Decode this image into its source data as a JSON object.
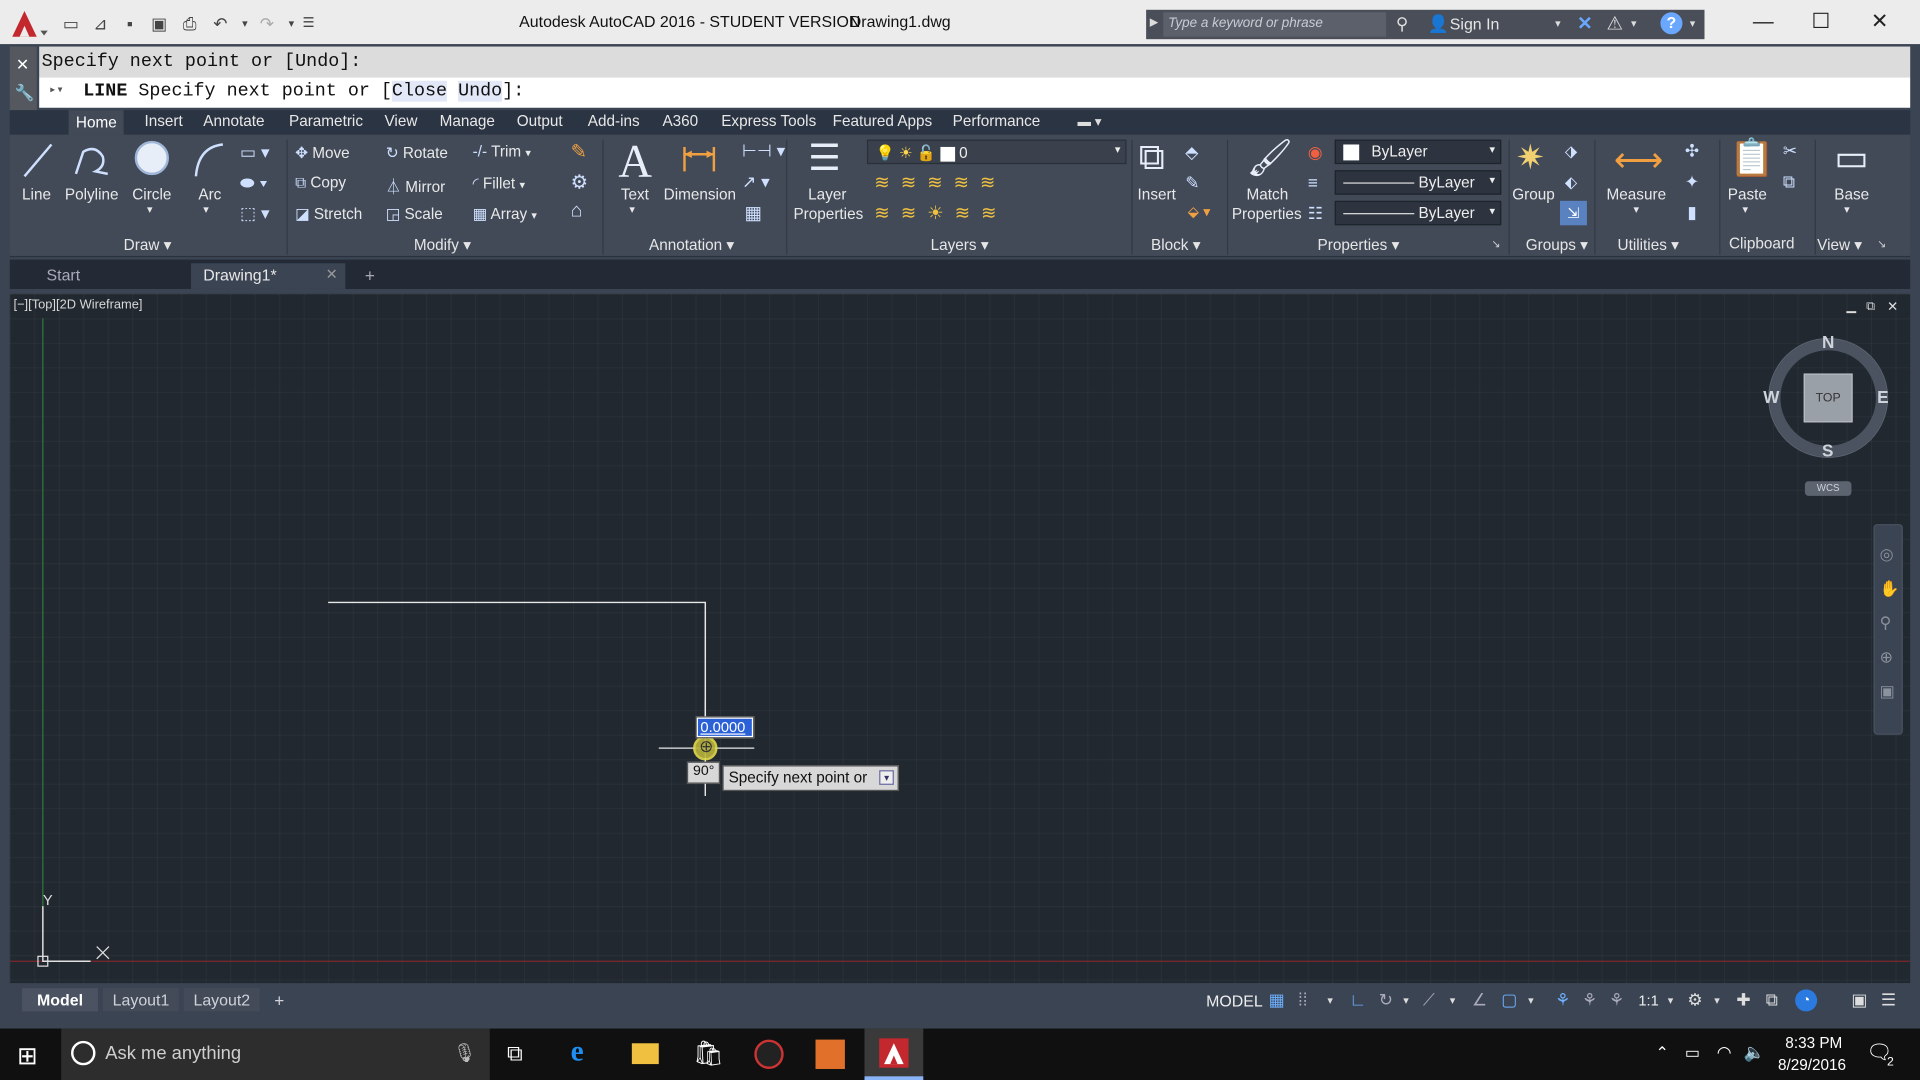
{
  "window": {
    "title": "Autodesk AutoCAD 2016 - STUDENT VERSION",
    "document": "Drawing1.dwg",
    "search_placeholder": "Type a keyword or phrase",
    "sign_in": "Sign In"
  },
  "command": {
    "history": "Specify next point or [Undo]:",
    "prompt_cmd": "LINE",
    "prompt_text": "Specify next point or [",
    "option_close": "Close",
    "option_undo": "Undo",
    "prompt_end": "]:"
  },
  "ribbon_tabs": [
    "Home",
    "Insert",
    "Annotate",
    "Parametric",
    "View",
    "Manage",
    "Output",
    "Add-ins",
    "A360",
    "Express Tools",
    "Featured Apps",
    "Performance"
  ],
  "draw": {
    "line": "Line",
    "polyline": "Polyline",
    "circle": "Circle",
    "arc": "Arc",
    "panel": "Draw"
  },
  "modify": {
    "move": "Move",
    "rotate": "Rotate",
    "trim": "Trim",
    "copy": "Copy",
    "mirror": "Mirror",
    "fillet": "Fillet",
    "stretch": "Stretch",
    "scale": "Scale",
    "array": "Array",
    "panel": "Modify"
  },
  "annotation": {
    "text": "Text",
    "dimension": "Dimension",
    "panel": "Annotation"
  },
  "layers": {
    "layer_properties_1": "Layer",
    "layer_properties_2": "Properties",
    "current_layer": "0",
    "panel": "Layers"
  },
  "block": {
    "insert": "Insert",
    "panel": "Block"
  },
  "properties": {
    "match_1": "Match",
    "match_2": "Properties",
    "color": "ByLayer",
    "linetype": "ByLayer",
    "lineweight": "ByLayer",
    "panel": "Properties"
  },
  "groups": {
    "group": "Group",
    "panel": "Groups"
  },
  "utilities": {
    "measure": "Measure",
    "panel": "Utilities"
  },
  "clipboard": {
    "paste": "Paste",
    "panel": "Clipboard"
  },
  "view": {
    "base": "Base",
    "panel": "View"
  },
  "file_tabs": {
    "start": "Start",
    "drawing": "Drawing1*"
  },
  "viewport": {
    "label": "[−][Top][2D Wireframe]",
    "input_value": "0.0000",
    "angle": "90°",
    "tooltip": "Specify next point or",
    "compass": {
      "n": "N",
      "s": "S",
      "e": "E",
      "w": "W",
      "top": "TOP",
      "wcs": "WCS"
    },
    "ucs_x": "X",
    "ucs_y": "Y"
  },
  "layout_tabs": [
    "Model",
    "Layout1",
    "Layout2"
  ],
  "status": {
    "model": "MODEL",
    "scale": "1:1"
  },
  "taskbar": {
    "search": "Ask me anything",
    "time": "8:33 PM",
    "date": "8/29/2016",
    "notifications": "2"
  }
}
